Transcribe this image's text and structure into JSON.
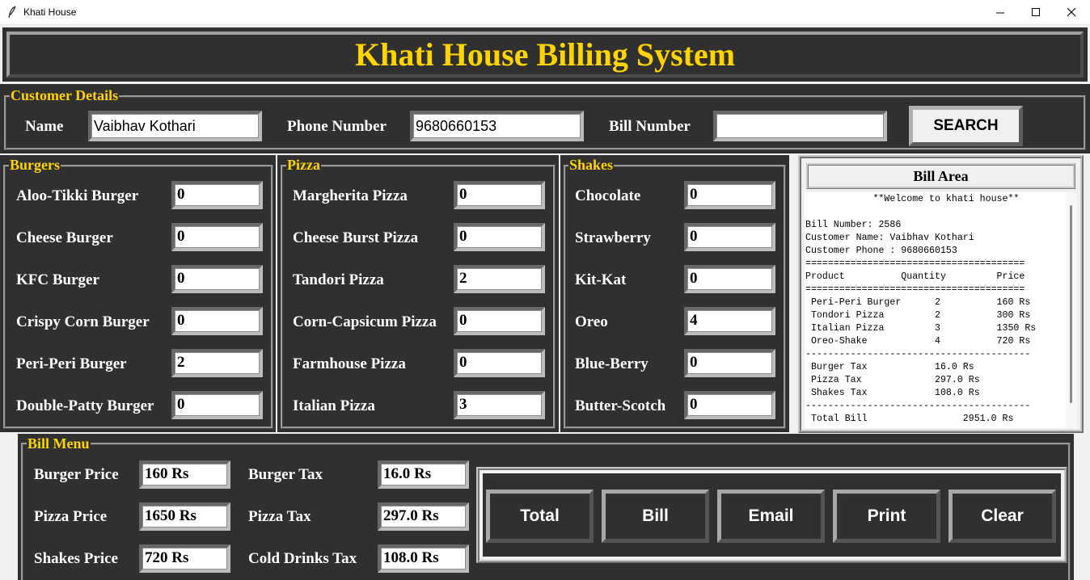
{
  "window": {
    "title": "Khati House"
  },
  "header": {
    "title": "Khati House Billing System"
  },
  "customer": {
    "legend": "Customer Details",
    "name_label": "Name",
    "name_value": "Vaibhav Kothari",
    "phone_label": "Phone Number",
    "phone_value": "9680660153",
    "bill_label": "Bill Number",
    "bill_value": "",
    "search_label": "SEARCH"
  },
  "burgers": {
    "legend": "Burgers",
    "items": [
      {
        "label": "Aloo-Tikki Burger",
        "qty": "0"
      },
      {
        "label": "Cheese Burger",
        "qty": "0"
      },
      {
        "label": "KFC Burger",
        "qty": "0"
      },
      {
        "label": "Crispy Corn Burger",
        "qty": "0"
      },
      {
        "label": "Peri-Peri Burger",
        "qty": "2"
      },
      {
        "label": "Double-Patty Burger",
        "qty": "0"
      }
    ]
  },
  "pizza": {
    "legend": "Pizza",
    "items": [
      {
        "label": "Margherita Pizza",
        "qty": "0"
      },
      {
        "label": "Cheese Burst Pizza",
        "qty": "0"
      },
      {
        "label": "Tandori Pizza",
        "qty": "2"
      },
      {
        "label": "Corn-Capsicum Pizza",
        "qty": "0"
      },
      {
        "label": "Farmhouse Pizza",
        "qty": "0"
      },
      {
        "label": "Italian Pizza",
        "qty": "3"
      }
    ]
  },
  "shakes": {
    "legend": "Shakes",
    "items": [
      {
        "label": "Chocolate",
        "qty": "0"
      },
      {
        "label": "Strawberry",
        "qty": "0"
      },
      {
        "label": "Kit-Kat",
        "qty": "0"
      },
      {
        "label": "Oreo",
        "qty": "4"
      },
      {
        "label": "Blue-Berry",
        "qty": "0"
      },
      {
        "label": "Butter-Scotch",
        "qty": "0"
      }
    ]
  },
  "bill_area": {
    "heading": "Bill Area",
    "lines": [
      "            **Welcome to khati house**",
      "",
      "Bill Number: 2586",
      "Customer Name: Vaibhav Kothari",
      "Customer Phone : 9680660153",
      "=======================================",
      "Product          Quantity         Price",
      "=======================================",
      " Peri-Peri Burger      2          160 Rs",
      " Tondori Pizza         2          300 Rs",
      " Italian Pizza         3          1350 Rs",
      " Oreo-Shake            4          720 Rs",
      "----------------------------------------",
      " Burger Tax            16.0 Rs",
      " Pizza Tax             297.0 Rs",
      " Shakes Tax            108.0 Rs",
      "----------------------------------------",
      " Total Bill                 2951.0 Rs"
    ]
  },
  "bill_menu": {
    "legend": "Bill Menu",
    "burger_price_label": "Burger Price",
    "burger_price_value": "160 Rs",
    "pizza_price_label": "Pizza Price",
    "pizza_price_value": "1650 Rs",
    "shakes_price_label": "Shakes Price",
    "shakes_price_value": "720 Rs",
    "burger_tax_label": "Burger Tax",
    "burger_tax_value": "16.0 Rs",
    "pizza_tax_label": "Pizza Tax",
    "pizza_tax_value": "297.0 Rs",
    "drinks_tax_label": "Cold Drinks Tax",
    "drinks_tax_value": "108.0 Rs"
  },
  "actions": {
    "total": "Total",
    "bill": "Bill",
    "email": "Email",
    "print": "Print",
    "clear": "Clear"
  },
  "colors": {
    "panel": "#303030",
    "accent": "#ffd400",
    "text": "#ffffff"
  }
}
